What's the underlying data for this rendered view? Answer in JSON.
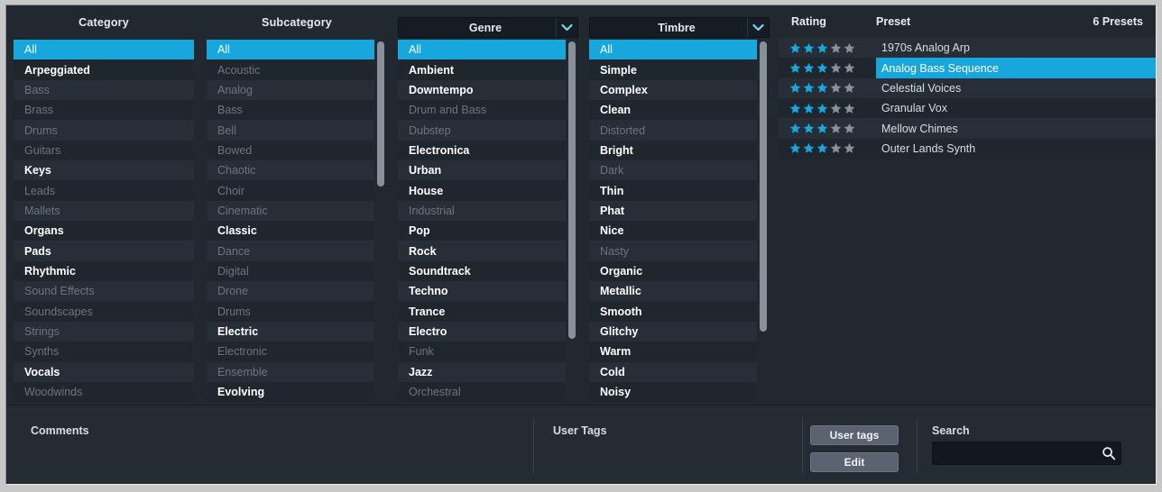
{
  "colors": {
    "accent": "#17a7dd",
    "panel_bg": "#222830",
    "bottom_bg": "#252b33",
    "row_even": "#272e37",
    "row_odd": "#20262e",
    "text_active": "#ffffff",
    "text_inactive": "#6c757f",
    "star_on": "#17a7dd",
    "star_off": "#8a9099",
    "button_bg": "#5b6270",
    "frame": "#c8c8c8"
  },
  "columns": {
    "category": {
      "header": "Category",
      "has_dropdown": false,
      "items": [
        {
          "label": "All",
          "state": "selected"
        },
        {
          "label": "Arpeggiated",
          "state": "active"
        },
        {
          "label": "Bass",
          "state": "inactive"
        },
        {
          "label": "Brass",
          "state": "inactive"
        },
        {
          "label": "Drums",
          "state": "inactive"
        },
        {
          "label": "Guitars",
          "state": "inactive"
        },
        {
          "label": "Keys",
          "state": "active"
        },
        {
          "label": "Leads",
          "state": "inactive"
        },
        {
          "label": "Mallets",
          "state": "inactive"
        },
        {
          "label": "Organs",
          "state": "active"
        },
        {
          "label": "Pads",
          "state": "active"
        },
        {
          "label": "Rhythmic",
          "state": "active"
        },
        {
          "label": "Sound Effects",
          "state": "inactive"
        },
        {
          "label": "Soundscapes",
          "state": "inactive"
        },
        {
          "label": "Strings",
          "state": "inactive"
        },
        {
          "label": "Synths",
          "state": "inactive"
        },
        {
          "label": "Vocals",
          "state": "active"
        },
        {
          "label": "Woodwinds",
          "state": "inactive"
        }
      ],
      "scrollbar": null
    },
    "subcategory": {
      "header": "Subcategory",
      "has_dropdown": false,
      "items": [
        {
          "label": "All",
          "state": "selected"
        },
        {
          "label": "Acoustic",
          "state": "inactive"
        },
        {
          "label": "Analog",
          "state": "inactive"
        },
        {
          "label": "Bass",
          "state": "inactive"
        },
        {
          "label": "Bell",
          "state": "inactive"
        },
        {
          "label": "Bowed",
          "state": "inactive"
        },
        {
          "label": "Chaotic",
          "state": "inactive"
        },
        {
          "label": "Choir",
          "state": "inactive"
        },
        {
          "label": "Cinematic",
          "state": "inactive"
        },
        {
          "label": "Classic",
          "state": "active"
        },
        {
          "label": "Dance",
          "state": "inactive"
        },
        {
          "label": "Digital",
          "state": "inactive"
        },
        {
          "label": "Drone",
          "state": "inactive"
        },
        {
          "label": "Drums",
          "state": "inactive"
        },
        {
          "label": "Electric",
          "state": "active"
        },
        {
          "label": "Electronic",
          "state": "inactive"
        },
        {
          "label": "Ensemble",
          "state": "inactive"
        },
        {
          "label": "Evolving",
          "state": "active"
        }
      ],
      "scrollbar": {
        "thumb_top_pct": 0,
        "thumb_height_pct": 40
      }
    },
    "genre": {
      "header": "Genre",
      "has_dropdown": true,
      "items": [
        {
          "label": "All",
          "state": "selected"
        },
        {
          "label": "Ambient",
          "state": "active"
        },
        {
          "label": "Downtempo",
          "state": "active"
        },
        {
          "label": "Drum and Bass",
          "state": "inactive"
        },
        {
          "label": "Dubstep",
          "state": "inactive"
        },
        {
          "label": "Electronica",
          "state": "active"
        },
        {
          "label": "Urban",
          "state": "active"
        },
        {
          "label": "House",
          "state": "active"
        },
        {
          "label": "Industrial",
          "state": "inactive"
        },
        {
          "label": "Pop",
          "state": "active"
        },
        {
          "label": "Rock",
          "state": "active"
        },
        {
          "label": "Soundtrack",
          "state": "active"
        },
        {
          "label": "Techno",
          "state": "active"
        },
        {
          "label": "Trance",
          "state": "active"
        },
        {
          "label": "Electro",
          "state": "active"
        },
        {
          "label": "Funk",
          "state": "inactive"
        },
        {
          "label": "Jazz",
          "state": "active"
        },
        {
          "label": "Orchestral",
          "state": "inactive"
        }
      ],
      "scrollbar": {
        "thumb_top_pct": 0,
        "thumb_height_pct": 82
      }
    },
    "timbre": {
      "header": "Timbre",
      "has_dropdown": true,
      "items": [
        {
          "label": "All",
          "state": "selected"
        },
        {
          "label": "Simple",
          "state": "active"
        },
        {
          "label": "Complex",
          "state": "active"
        },
        {
          "label": "Clean",
          "state": "active"
        },
        {
          "label": "Distorted",
          "state": "inactive"
        },
        {
          "label": "Bright",
          "state": "active"
        },
        {
          "label": "Dark",
          "state": "inactive"
        },
        {
          "label": "Thin",
          "state": "active"
        },
        {
          "label": "Phat",
          "state": "active"
        },
        {
          "label": "Nice",
          "state": "active"
        },
        {
          "label": "Nasty",
          "state": "inactive"
        },
        {
          "label": "Organic",
          "state": "active"
        },
        {
          "label": "Metallic",
          "state": "active"
        },
        {
          "label": "Smooth",
          "state": "active"
        },
        {
          "label": "Glitchy",
          "state": "active"
        },
        {
          "label": "Warm",
          "state": "active"
        },
        {
          "label": "Cold",
          "state": "active"
        },
        {
          "label": "Noisy",
          "state": "active"
        }
      ],
      "scrollbar": {
        "thumb_top_pct": 0,
        "thumb_height_pct": 80
      }
    }
  },
  "presets": {
    "header": {
      "rating": "Rating",
      "preset": "Preset",
      "count": "6 Presets"
    },
    "max_stars": 5,
    "rows": [
      {
        "name": "1970s Analog Arp",
        "rating": 3,
        "selected": false
      },
      {
        "name": "Analog Bass Sequence",
        "rating": 3,
        "selected": true
      },
      {
        "name": "Celestial Voices",
        "rating": 3,
        "selected": false
      },
      {
        "name": "Granular Vox",
        "rating": 3,
        "selected": false
      },
      {
        "name": "Mellow Chimes",
        "rating": 3,
        "selected": false
      },
      {
        "name": "Outer Lands Synth",
        "rating": 3,
        "selected": false
      }
    ]
  },
  "bottom": {
    "comments_label": "Comments",
    "comments_value": "",
    "user_tags_label": "User Tags",
    "user_tags_value": "",
    "user_tags_button": "User tags",
    "edit_button": "Edit",
    "search_label": "Search",
    "search_value": "",
    "search_placeholder": ""
  },
  "icons": {
    "chevron_down": "chevron-down-icon",
    "search": "search-icon",
    "star": "star-icon"
  }
}
